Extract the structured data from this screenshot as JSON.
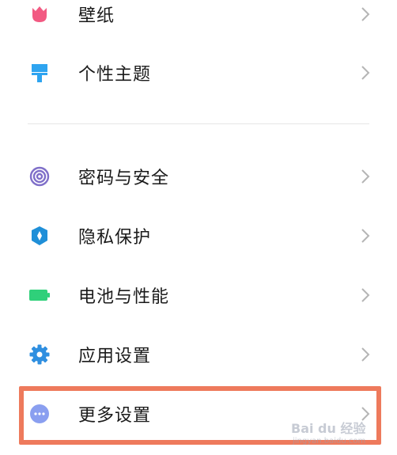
{
  "settings": {
    "items": [
      {
        "label": "壁纸",
        "icon": "tulip-icon",
        "color": "#f25a82"
      },
      {
        "label": "个性主题",
        "icon": "paint-brush-icon",
        "color": "#2ea4f0"
      },
      {
        "label": "密码与安全",
        "icon": "fingerprint-icon",
        "color": "#7f6fc9"
      },
      {
        "label": "隐私保护",
        "icon": "privacy-shield-icon",
        "color": "#1f8fd8"
      },
      {
        "label": "电池与性能",
        "icon": "battery-icon",
        "color": "#2fd07a"
      },
      {
        "label": "应用设置",
        "icon": "gear-icon",
        "color": "#2f8fe0"
      },
      {
        "label": "更多设置",
        "icon": "more-dots-icon",
        "color": "#8a9ff0"
      }
    ],
    "highlighted_item": "更多设置",
    "highlight_color": "#ee7a5c"
  },
  "watermark": {
    "logo": "Bai du 经验",
    "url": "jingyan.baidu.com"
  }
}
